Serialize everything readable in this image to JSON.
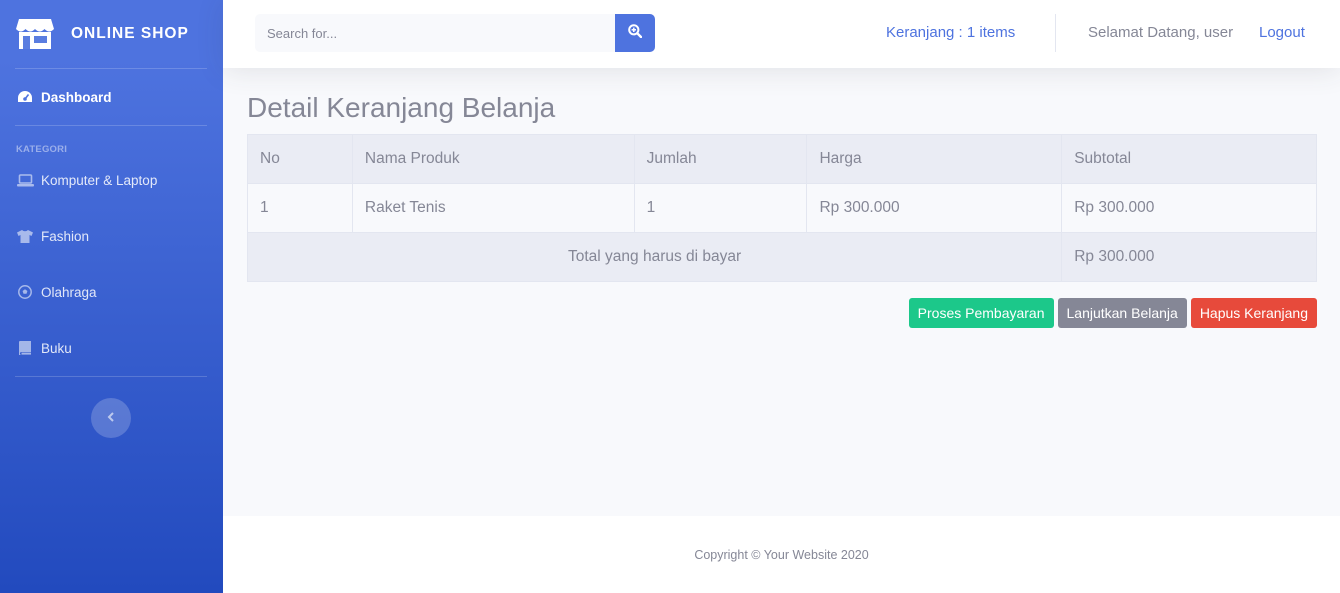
{
  "brand": {
    "name": "ONLINE SHOP",
    "icon": "store-icon"
  },
  "sidebar": {
    "dashboard": {
      "label": "Dashboard",
      "icon": "tachometer-icon"
    },
    "heading": "KATEGORI",
    "categories": [
      {
        "label": "Komputer & Laptop",
        "icon": "laptop-icon"
      },
      {
        "label": "Fashion",
        "icon": "tshirt-icon"
      },
      {
        "label": "Olahraga",
        "icon": "futbol-icon"
      },
      {
        "label": "Buku",
        "icon": "book-icon"
      }
    ],
    "toggle_icon": "chevron-left-icon"
  },
  "topbar": {
    "search_placeholder": "Search for...",
    "search_icon": "search-plus-icon",
    "cart": "Keranjang : 1 items",
    "welcome": "Selamat Datang, user",
    "logout": "Logout"
  },
  "main": {
    "title": "Detail Keranjang Belanja",
    "table": {
      "headers": [
        "No",
        "Nama Produk",
        "Jumlah",
        "Harga",
        "Subtotal"
      ],
      "rows": [
        [
          "1",
          "Raket Tenis",
          "1",
          "Rp 300.000",
          "Rp 300.000"
        ]
      ],
      "total_label": "Total yang harus di bayar",
      "total_value": "Rp 300.000"
    },
    "buttons": {
      "pay": "Proses Pembayaran",
      "continue": "Lanjutkan Belanja",
      "clear": "Hapus Keranjang"
    }
  },
  "footer": {
    "copyright": "Copyright © Your Website 2020"
  },
  "colors": {
    "primary": "#4e73df",
    "success": "#1cc88a",
    "secondary": "#858796",
    "danger": "#e74a3b"
  }
}
